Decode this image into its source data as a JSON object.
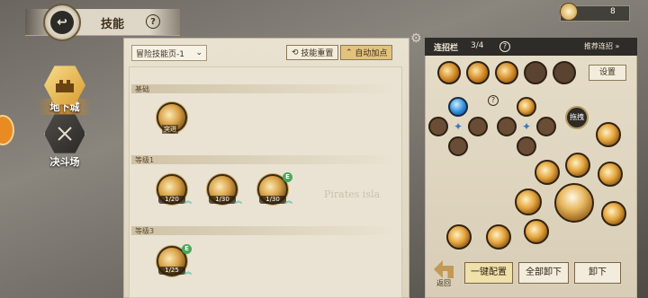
{
  "header": {
    "title": "技能",
    "help": "?"
  },
  "currency": {
    "value": "8"
  },
  "modes": [
    {
      "label": "地下城",
      "active": true
    },
    {
      "label": "决斗场",
      "active": false
    }
  ],
  "skill_panel": {
    "page_select": "冒险技能页-1",
    "reset_label": "技能重置",
    "auto_label": "自动加点",
    "sections": [
      {
        "title": "基础"
      },
      {
        "title": "等级1"
      },
      {
        "title": "等级3"
      }
    ],
    "skills": {
      "basic": {
        "name": "突进"
      },
      "lv1a": {
        "level": "1/20"
      },
      "lv1b": {
        "level": "1/30"
      },
      "lv1c": {
        "level": "1/30",
        "badge": "E"
      },
      "lv3a": {
        "level": "1/25",
        "badge": "E"
      }
    },
    "watermark": "Pirates isla"
  },
  "combo_panel": {
    "title": "连招栏",
    "count": "3/4",
    "help": "?",
    "recommend_label": "推荐连招 »",
    "setting_label": "设置",
    "drag_label": "拖拽",
    "one_key_label": "一键配置",
    "unload_all_label": "全部卸下",
    "unload_label": "卸下",
    "return_label": "返回"
  },
  "colors": {
    "accent_gold": "#d8a046",
    "header_dark": "#2e2c29",
    "upgrade_green": "#1fb38a"
  }
}
